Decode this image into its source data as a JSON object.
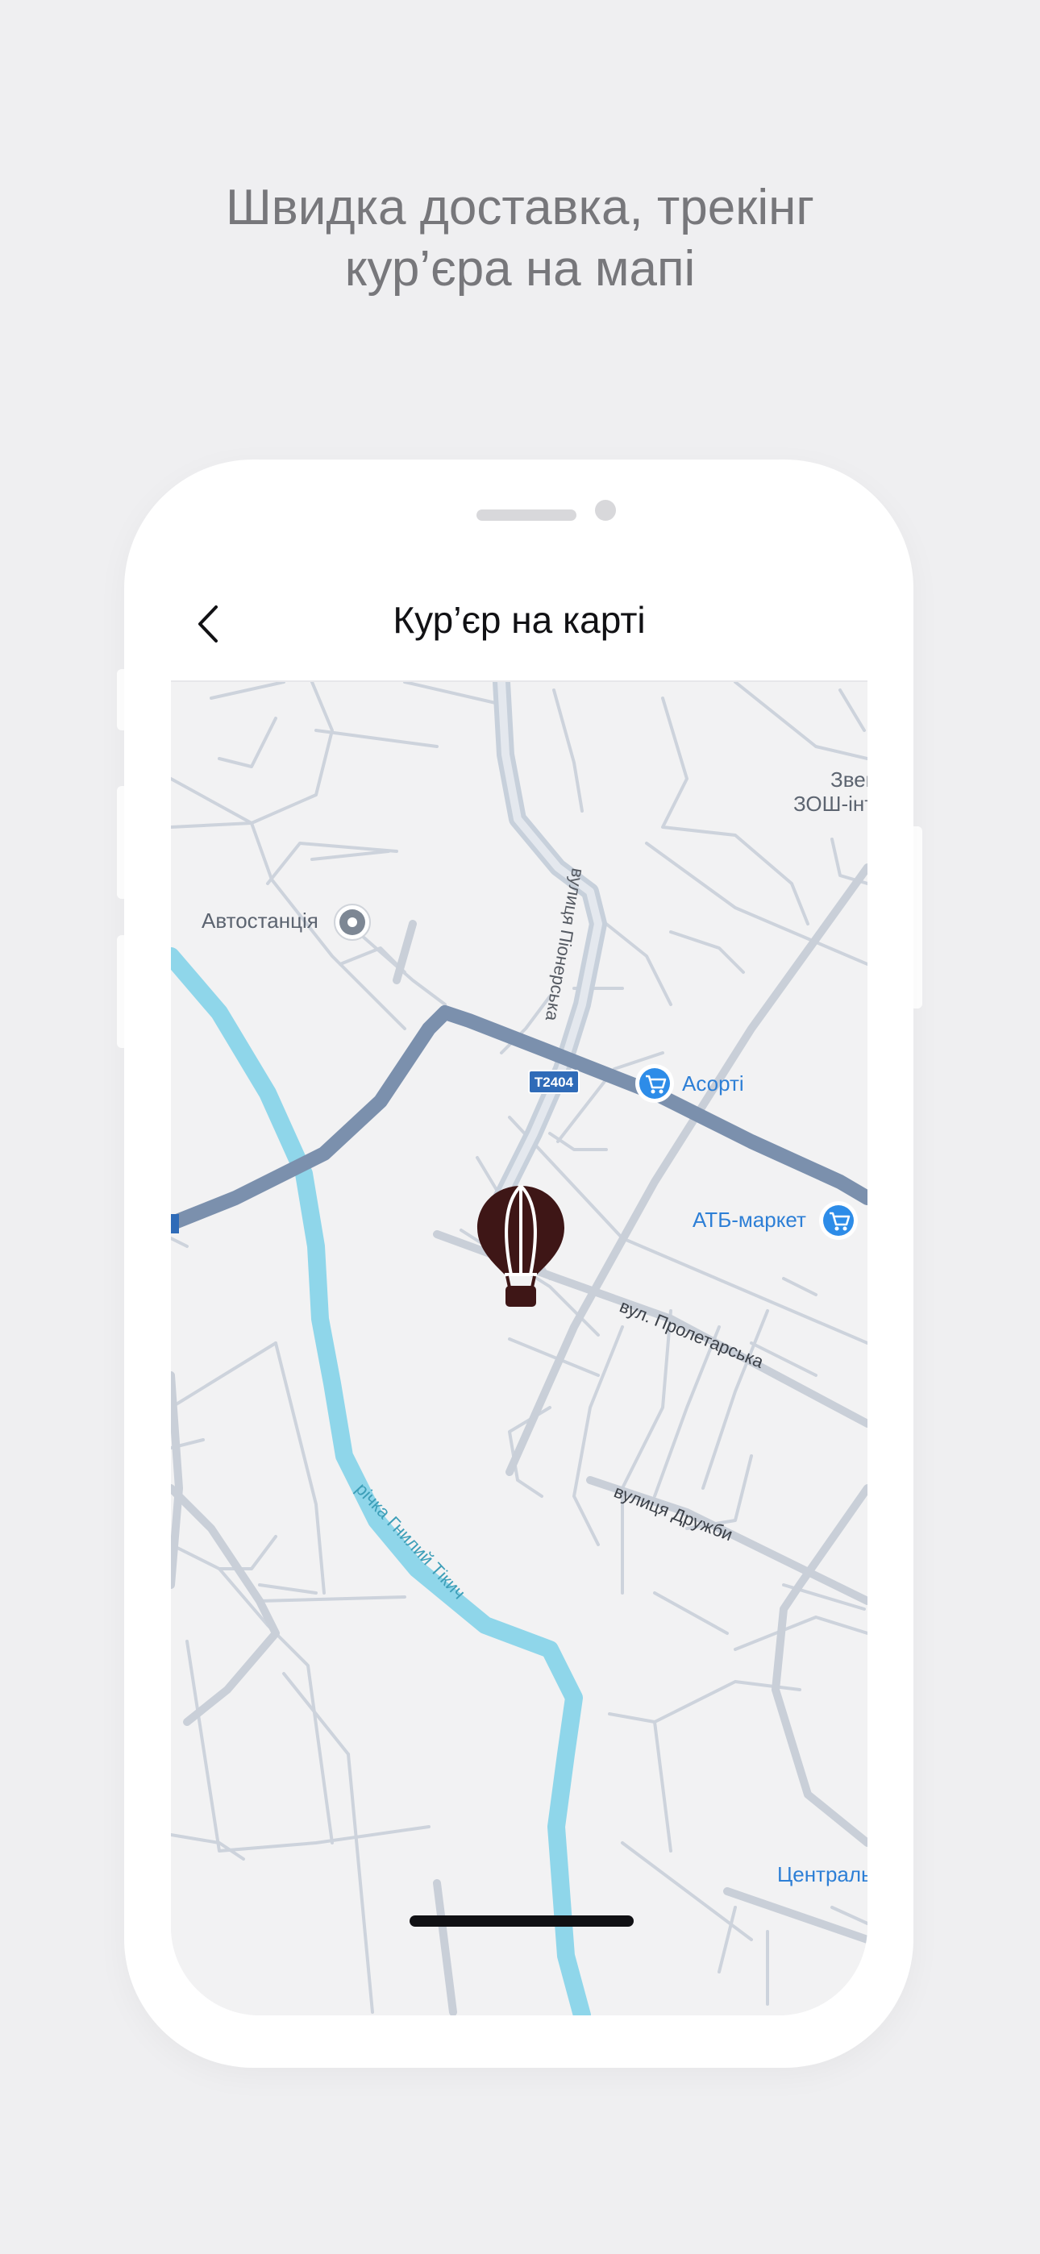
{
  "headline": {
    "line1": "Швидка доставка, трекінг",
    "line2": "кур’єра на мапі"
  },
  "screen": {
    "title": "Кур’єр на карті",
    "back_icon": "chevron-left-icon"
  },
  "map": {
    "labels": {
      "bus_station": "Автостанція",
      "shop_asorti": "Асорті",
      "shop_atb": "АТБ-маркет",
      "school_line1": "Звен",
      "school_line2": "ЗОШ-інт",
      "street_pionerska": "вулиця Піонерська",
      "road_badge": "T2404",
      "street_proletarska": "вул. Пролетарська",
      "street_druzhby": "вулиця Дружби",
      "river": "річка Гнилий Тікич",
      "center": "Централь"
    },
    "colors": {
      "background": "#f2f2f3",
      "road": "#c9cfd8",
      "highway": "#7b90ad",
      "river": "#8fd6ea",
      "poi_blue": "#2d8ce8",
      "courier_marker": "#3e1616"
    },
    "courier_icon": "hot-air-balloon-icon",
    "shop_icon": "shopping-cart-icon",
    "station_icon": "location-pin-icon"
  }
}
